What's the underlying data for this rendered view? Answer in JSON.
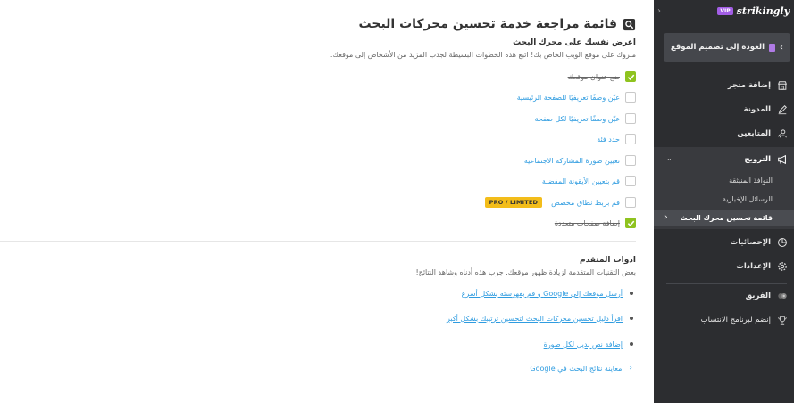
{
  "main": {
    "title": "قائمة مراجعة خدمة تحسين محركات البحث",
    "intro_heading": "اعرض نفسك على محرك البحث",
    "intro_desc": "مبروك على موقع الويب الخاص بك! اتبع هذه الخطوات البسيطة لجذب المزيد من الأشخاص إلى موقعك.",
    "checklist": [
      {
        "label": "ضع عنوان موقعك",
        "checked": true
      },
      {
        "label": "عيّن وصفًا تعريفيًا للصفحة الرئيسية",
        "checked": false
      },
      {
        "label": "عيّن وصفًا تعريفيًا لكل صفحة",
        "checked": false
      },
      {
        "label": "حدد فئة",
        "checked": false
      },
      {
        "label": "تعيين صورة المشاركة الاجتماعية",
        "checked": false
      },
      {
        "label": "قم بتعيين الأيقونة المفضلة",
        "checked": false
      },
      {
        "label": "قم بربط نطاق مخصص",
        "checked": false,
        "badge": "PRO / LIMITED"
      },
      {
        "label": "إضافة صفحات متعددة",
        "checked": true
      }
    ],
    "advanced_heading": "ادوات المتقدم",
    "advanced_desc": "بعض التقنيات المتقدمة لزيادة ظهور موقعك. جرب هذه أدناه وشاهد النتائج!",
    "advanced_links": [
      "أرسل موقعك إلى Google و قم بفهرسته بشكل أسرع",
      "اقرأ دليل تحسين محركات البحث لتحسين ترتيبك بشكل أكبر",
      "إضافة نص بديل لكل صورة"
    ],
    "preview_link": "معاينة نتائج البحث في Google"
  },
  "sidebar": {
    "brand": "strikingly",
    "vip_badge": "VIP",
    "back_button": "العودة إلى تصميم الموقع",
    "items": [
      {
        "label": "إضافة متجر",
        "icon": "store-icon"
      },
      {
        "label": "المدونة",
        "icon": "pen-icon"
      },
      {
        "label": "المتابعين",
        "icon": "users-icon"
      }
    ],
    "promotion": {
      "label": "الترويج",
      "icon": "megaphone-icon",
      "subitems": [
        {
          "label": "النوافذ المنبثقة",
          "active": false
        },
        {
          "label": "الرسائل الإخبارية",
          "active": false
        },
        {
          "label": "قائمة تحسين محرك البحث",
          "active": true
        }
      ]
    },
    "bottom_items": [
      {
        "label": "الإحصائيات",
        "icon": "pie-chart-icon"
      },
      {
        "label": "الإعدادات",
        "icon": "gear-icon"
      }
    ],
    "team_items": [
      {
        "label": "الفريق",
        "icon": "team-icon"
      },
      {
        "label": "إنضم لبرنامج الانتساب",
        "icon": "trophy-icon"
      }
    ]
  },
  "colors": {
    "accent_link": "#2f9ce0",
    "check_green": "#8fc31f",
    "pro_badge": "#f3bd1a",
    "sidebar_bg": "#2c2d30",
    "vip": "#a35ee6"
  }
}
